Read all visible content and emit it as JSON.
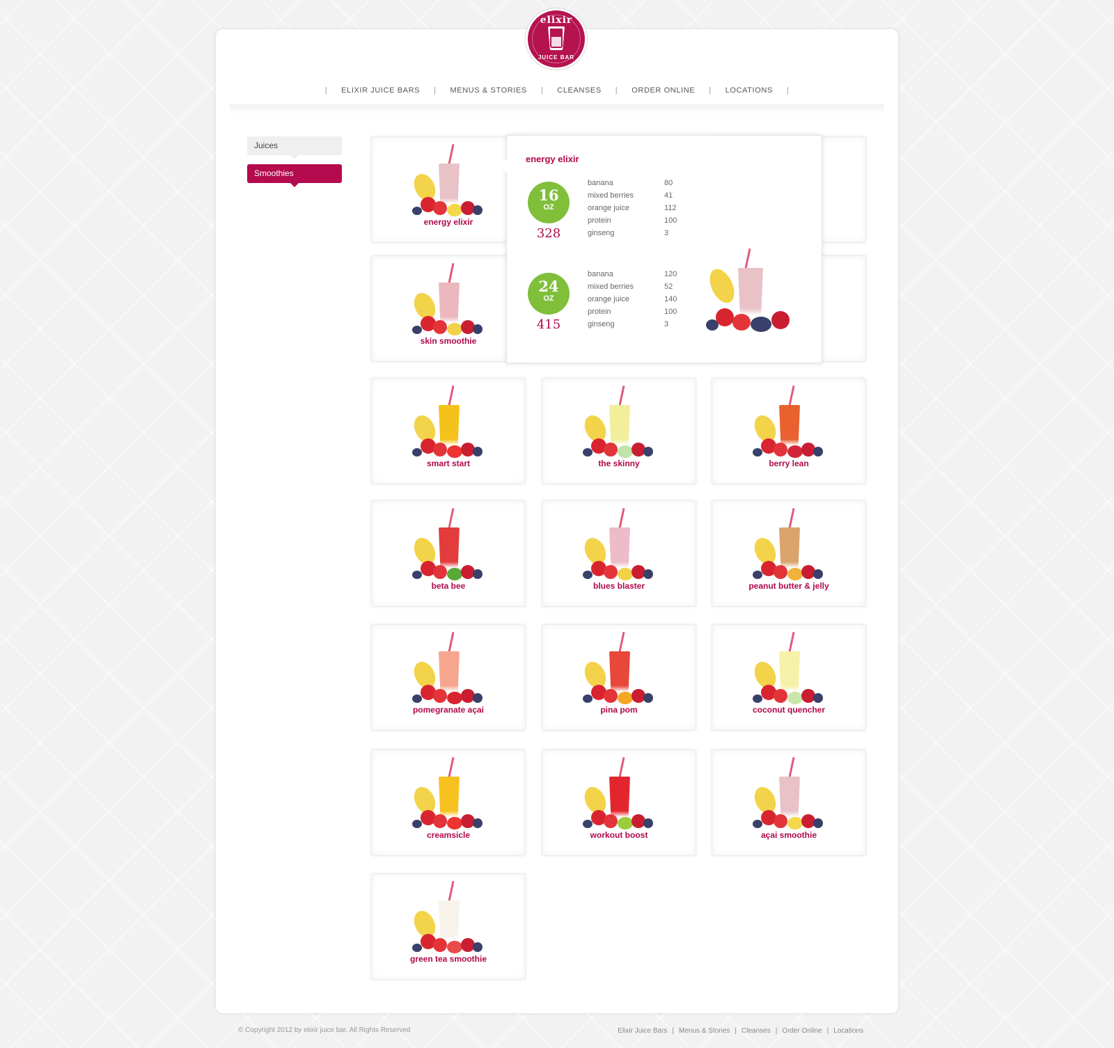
{
  "brand": {
    "logo_top": "elixir",
    "logo_bottom": "JUICE BAR",
    "color": "#b40a4e"
  },
  "nav": {
    "items": [
      "ELIXIR JUICE BARS",
      "MENUS & STORIES",
      "CLEANSES",
      "ORDER ONLINE",
      "LOCATIONS"
    ]
  },
  "sidebar": {
    "tabs": [
      "Juices",
      "Smoothies"
    ],
    "active": "Smoothies"
  },
  "products": [
    "energy elixir",
    "skin smoothie",
    "smart start",
    "the skinny",
    "berry lean",
    "beta bee",
    "blues blaster",
    "peanut butter & jelly",
    "pomegranate açai",
    "pina pom",
    "coconut quencher",
    "creamsicle",
    "workout boost",
    "açai smoothie",
    "green tea smoothie"
  ],
  "popup": {
    "title": "energy elixir",
    "sizes": [
      {
        "size": "16",
        "unit": "OZ",
        "calories": "328",
        "ingredients": [
          {
            "name": "banana",
            "value": "80"
          },
          {
            "name": "mixed berries",
            "value": "41"
          },
          {
            "name": "orange juice",
            "value": "112"
          },
          {
            "name": "protein",
            "value": "100"
          },
          {
            "name": "ginseng",
            "value": "3"
          }
        ]
      },
      {
        "size": "24",
        "unit": "OZ",
        "calories": "415",
        "ingredients": [
          {
            "name": "banana",
            "value": "120"
          },
          {
            "name": "mixed berries",
            "value": "52"
          },
          {
            "name": "orange juice",
            "value": "140"
          },
          {
            "name": "protein",
            "value": "100"
          },
          {
            "name": "ginseng",
            "value": "3"
          }
        ]
      }
    ]
  },
  "footer": {
    "copyright": "© Copyright 2012 by elixir juice bar. All Rights Reserved",
    "links": [
      "Elixir Juice Bars",
      "Menus & Stories",
      "Cleanses",
      "Order Online",
      "Locations"
    ]
  }
}
